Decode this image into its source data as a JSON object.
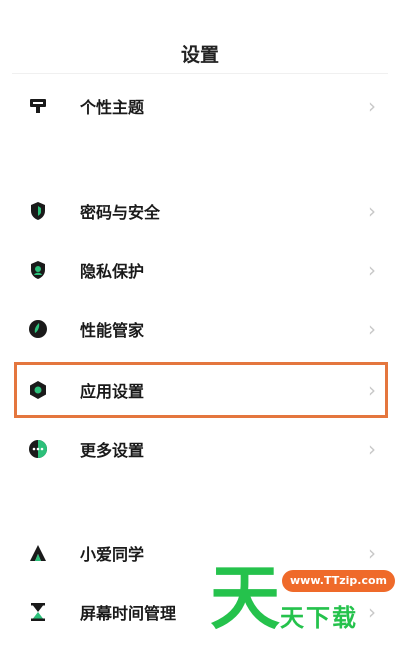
{
  "header": {
    "title": "设置"
  },
  "items": [
    {
      "label": "个性主题",
      "icon": "theme-icon"
    },
    {
      "label": "密码与安全",
      "icon": "shield-lock-icon"
    },
    {
      "label": "隐私保护",
      "icon": "privacy-shield-icon"
    },
    {
      "label": "性能管家",
      "icon": "performance-icon"
    },
    {
      "label": "应用设置",
      "icon": "app-settings-icon"
    },
    {
      "label": "更多设置",
      "icon": "more-settings-icon"
    },
    {
      "label": "小爱同学",
      "icon": "xiaoai-icon"
    },
    {
      "label": "屏幕时间管理",
      "icon": "hourglass-icon"
    }
  ],
  "chevron": "›",
  "highlight_color": "#e4763e",
  "watermark": {
    "url": "www.TTzip.com",
    "big_char": "天",
    "text": "天下载"
  }
}
